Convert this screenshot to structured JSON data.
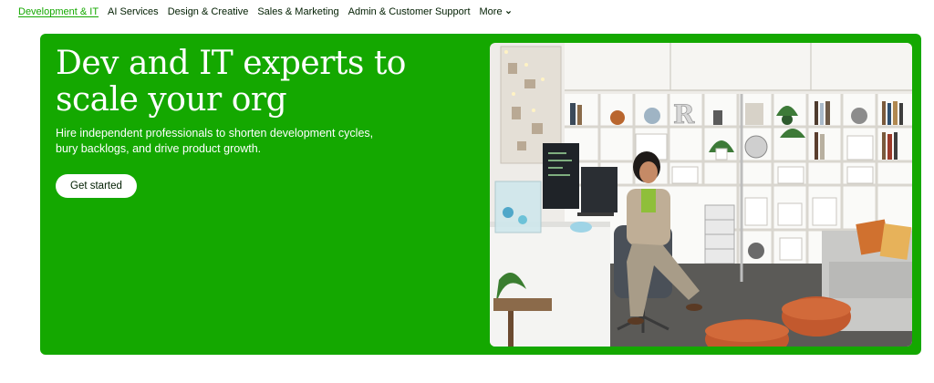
{
  "nav": {
    "items": [
      {
        "label": "Development & IT",
        "active": true
      },
      {
        "label": "AI Services"
      },
      {
        "label": "Design & Creative"
      },
      {
        "label": "Sales & Marketing"
      },
      {
        "label": "Admin & Customer Support"
      }
    ],
    "more_label": "More",
    "more_icon": "chevron-down-icon"
  },
  "hero": {
    "title_line1": "Dev and IT experts to",
    "title_line2": "scale your org",
    "subtitle_line1": "Hire independent professionals to shorten development cycles,",
    "subtitle_line2": "bury backlogs, and drive product growth.",
    "cta_label": "Get started",
    "photo_letter": "R"
  },
  "colors": {
    "brand_green": "#14a800",
    "text_dark": "#001e00",
    "white": "#ffffff"
  }
}
